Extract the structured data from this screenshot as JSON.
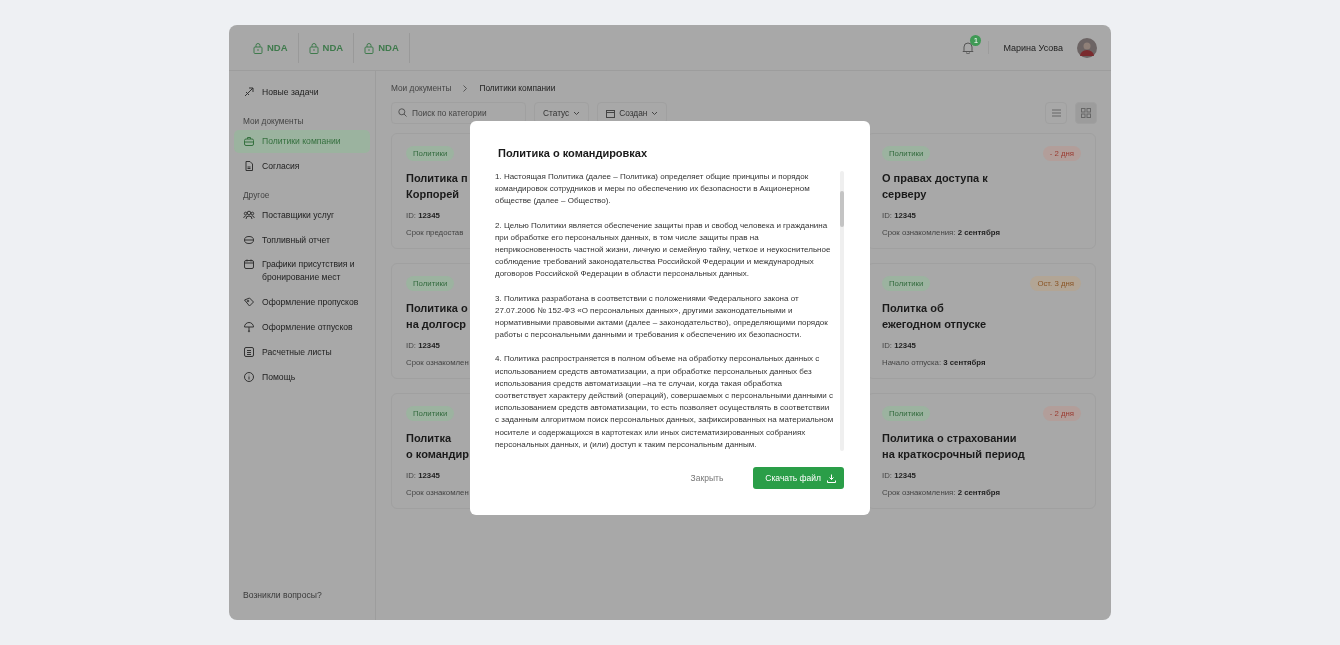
{
  "topbar": {
    "tabs": [
      {
        "label": "NDA"
      },
      {
        "label": "NDA"
      },
      {
        "label": "NDA"
      }
    ],
    "notifications": {
      "badge": "1"
    },
    "user": {
      "name": "Марина Усова"
    }
  },
  "sidebar": {
    "items": [
      {
        "kind": "item",
        "label": "Новые задачи",
        "selected": false
      },
      {
        "kind": "section",
        "label": "Мои документы"
      },
      {
        "kind": "item",
        "label": "Политики компании",
        "selected": true
      },
      {
        "kind": "item",
        "label": "Согласия",
        "selected": false
      },
      {
        "kind": "section",
        "label": "Другое"
      },
      {
        "kind": "item",
        "label": "Поставщики услуг",
        "selected": false
      },
      {
        "kind": "item",
        "label": "Топливный отчет",
        "selected": false
      },
      {
        "kind": "item",
        "label": "Графики присутствия и бронирование мест",
        "selected": false
      },
      {
        "kind": "item",
        "label": "Оформление пропусков",
        "selected": false
      },
      {
        "kind": "item",
        "label": "Оформление отпусков",
        "selected": false
      },
      {
        "kind": "item",
        "label": "Расчетные листы",
        "selected": false
      },
      {
        "kind": "item",
        "label": "Помощь",
        "selected": false
      }
    ],
    "footer": "Возникли вопросы?"
  },
  "breadcrumbs": [
    "Мои документы",
    "Политики компании"
  ],
  "toolbar": {
    "search": {
      "placeholder": "Поиск по категории"
    },
    "filters": [
      "Статус",
      "Создан"
    ],
    "views": [
      {
        "kind": "list",
        "selected": false
      },
      {
        "kind": "grid",
        "selected": true
      }
    ]
  },
  "card_columns": [
    [
      {
        "tag": "Политики",
        "title_lines": [
          "Политика п",
          "Корпорей"
        ],
        "id_label": "ID:",
        "id": "12345",
        "date_label": "Срок предостав"
      },
      {
        "tag": "Политики",
        "title_lines": [
          "Политика о",
          "на долгоср"
        ],
        "id_label": "ID:",
        "id": "12345",
        "date_label": "Срок ознакомлен"
      },
      {
        "tag": "Политики",
        "title_lines": [
          "Политка",
          "о командир"
        ],
        "id_label": "ID:",
        "id": "12345",
        "date_label": "Срок ознакомлен"
      }
    ],
    [
      {
        "tag": "Политики",
        "badge": {
          "text": "- 2 дня",
          "kind": "overdue"
        },
        "title_lines": [
          "О правах доступа к",
          "серверу"
        ],
        "id_label": "ID:",
        "id": "12345",
        "date_label": "Срок ознакомления:",
        "date": "2 сентября"
      },
      {
        "tag": "Политики",
        "badge": {
          "text": "Ост. 3 дня",
          "kind": "remaining"
        },
        "title_lines": [
          "Политка об",
          "ежегодном отпуске"
        ],
        "id_label": "ID:",
        "id": "12345",
        "date_label": "Начало отпуска:",
        "date": "3 сентября"
      },
      {
        "tag": "Политики",
        "badge": {
          "text": "- 2 дня",
          "kind": "overdue"
        },
        "title_lines": [
          "Политика о страховании",
          "на краткосрочный период"
        ],
        "id_label": "ID:",
        "id": "12345",
        "date_label": "Срок ознакомления:",
        "date": "2 сентября"
      }
    ]
  ],
  "modal": {
    "title": "Политика о командировках",
    "paragraphs": [
      "1. Настоящая Политика (далее – Политика) определяет общие принципы и порядок командировок сотрудников и меры по обеспечению их безопасности в Акционерном обществе (далее – Общество).",
      "2. Целью Политики является обеспечение защиты прав и свобод человека и гражданина при обработке его персональных данных, в том числе защиты прав на неприкосновенность частной жизни, личную и семейную тайну, четкое и неукоснительное соблюдение требований законодательства Российской Федерации и международных договоров Российской Федерации в области персональных данных.",
      "3. Политика разработана в соответствии с положениями Федерального закона от 27.07.2006 № 152-ФЗ «О персональных данных», другими законодательными и нормативными правовыми актами (далее – законодательство), определяющими порядок работы с персональными данными и требования к обеспечению их безопасности.",
      "4. Политика распространяется в полном объеме на обработку персональных данных с использованием средств автоматизации, а при обработке персональных данных без использования средств автоматизации –на те случаи, когда такая обработка соответствует характеру действий (операций), совершаемых с персональными данными с использованием средств автоматизации, то есть позволяет осуществлять в соответствии с заданным алгоритмом поиск персональных данных, зафиксированных на материальном носителе и содержащихся в картотеках или иных систематизированных собраниях персональных данных, и (или) доступ к таким персональным данным."
    ],
    "buttons": [
      {
        "kind": "secondary",
        "label": "Закрыть"
      },
      {
        "kind": "primary",
        "label": "Скачать файл"
      }
    ]
  }
}
